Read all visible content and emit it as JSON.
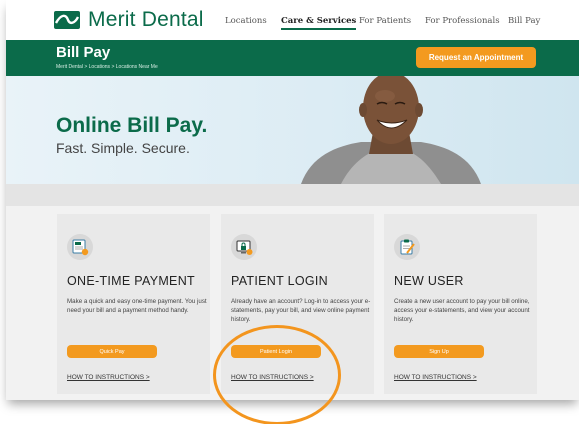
{
  "brand": {
    "name": "Merit Dental",
    "color": "#0b6b4a",
    "accent": "#f39a1f"
  },
  "nav": [
    {
      "label": "Locations",
      "active": false
    },
    {
      "label": "Care & Services",
      "active": true
    },
    {
      "label": "For Patients",
      "active": false
    },
    {
      "label": "For Professionals",
      "active": false
    },
    {
      "label": "Bill Pay",
      "active": false
    }
  ],
  "header": {
    "title": "Bill Pay",
    "breadcrumb": "Merit Dental > Locations > Locations Near Me",
    "appointment_button": "Request an Appointment"
  },
  "hero": {
    "title": "Online Bill Pay.",
    "subtitle": "Fast. Simple. Secure."
  },
  "cards": [
    {
      "icon": "bill-document-icon",
      "title": "ONE-TIME PAYMENT",
      "body": "Make a quick and easy one-time payment. You just need your bill and a payment method handy.",
      "button": "Quick Pay",
      "link": "HOW TO INSTRUCTIONS >"
    },
    {
      "icon": "secure-login-icon",
      "title": "PATIENT LOGIN",
      "body": "Already have an account? Log-in to access your e-statements, pay your bill, and view online payment history.",
      "button": "Patient Login",
      "link": "HOW TO INSTRUCTIONS >"
    },
    {
      "icon": "clipboard-edit-icon",
      "title": "NEW USER",
      "body": "Create a new user account to pay your bill online, access your e-statements, and view your account history.",
      "button": "Sign Up",
      "link": "HOW TO INSTRUCTIONS >"
    }
  ],
  "annotation": {
    "color": "#f3951e",
    "shape": "circle"
  }
}
